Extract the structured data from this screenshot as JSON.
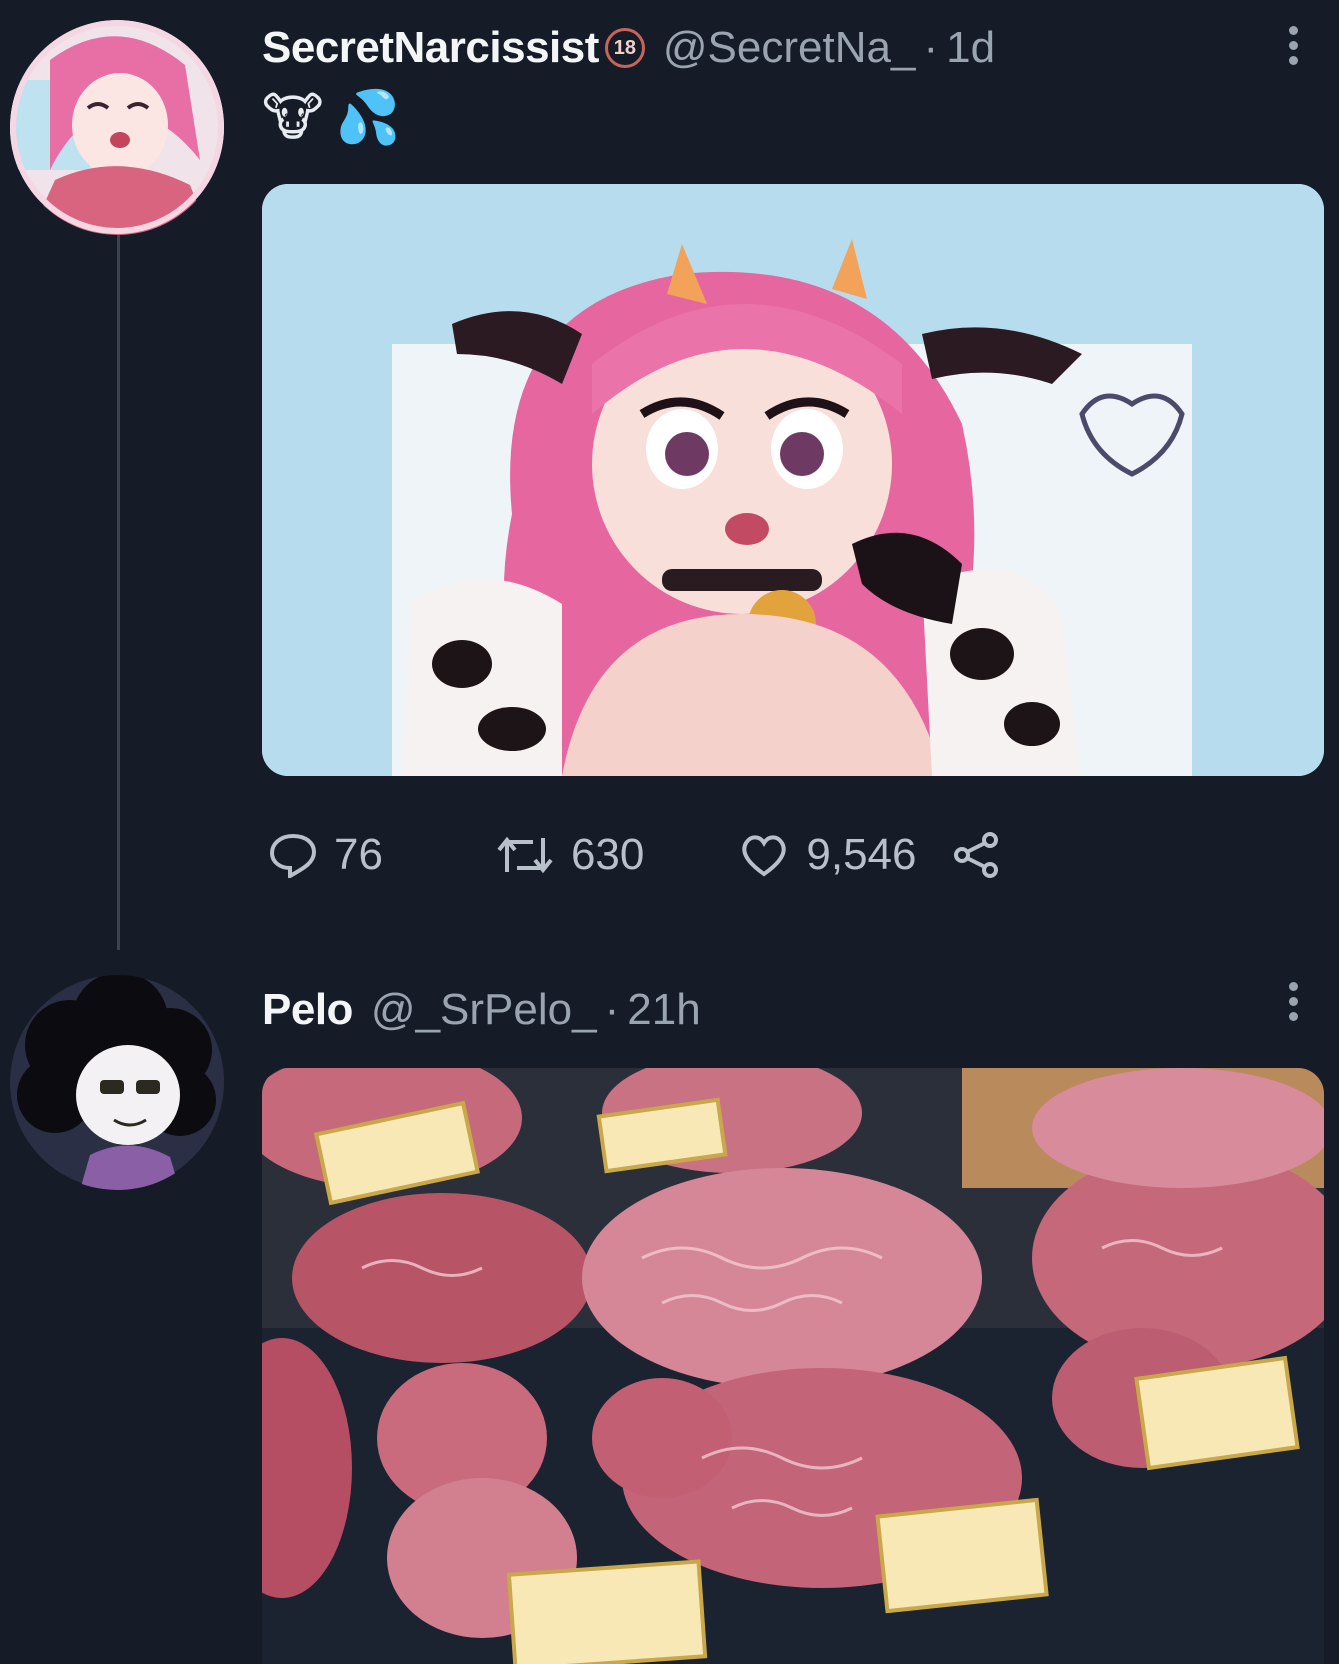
{
  "tweet": {
    "display_name": "SecretNarcissist",
    "age_badge": "18",
    "handle": "@SecretNa_",
    "separator": "·",
    "time": "1d",
    "text_emojis": [
      "🐮",
      "💦"
    ],
    "media_description_icon": "anime-cow-girl-image",
    "stats": {
      "replies": "76",
      "retweets": "630",
      "likes": "9,546"
    },
    "icons": {
      "reply": "speech-bubble-icon",
      "retweet": "retweet-arrows-icon",
      "like": "heart-icon",
      "share": "share-nodes-icon",
      "more": "vertical-dots-icon"
    }
  },
  "reply": {
    "display_name": "Pelo",
    "handle": "@_SrPelo_",
    "separator": "·",
    "time": "21h",
    "media_description_icon": "wagyu-beef-display-image"
  },
  "colors": {
    "background": "#151c27",
    "text_primary": "#f3f5f7",
    "text_secondary": "#9aa4b0",
    "thread_line": "#3a4350"
  }
}
